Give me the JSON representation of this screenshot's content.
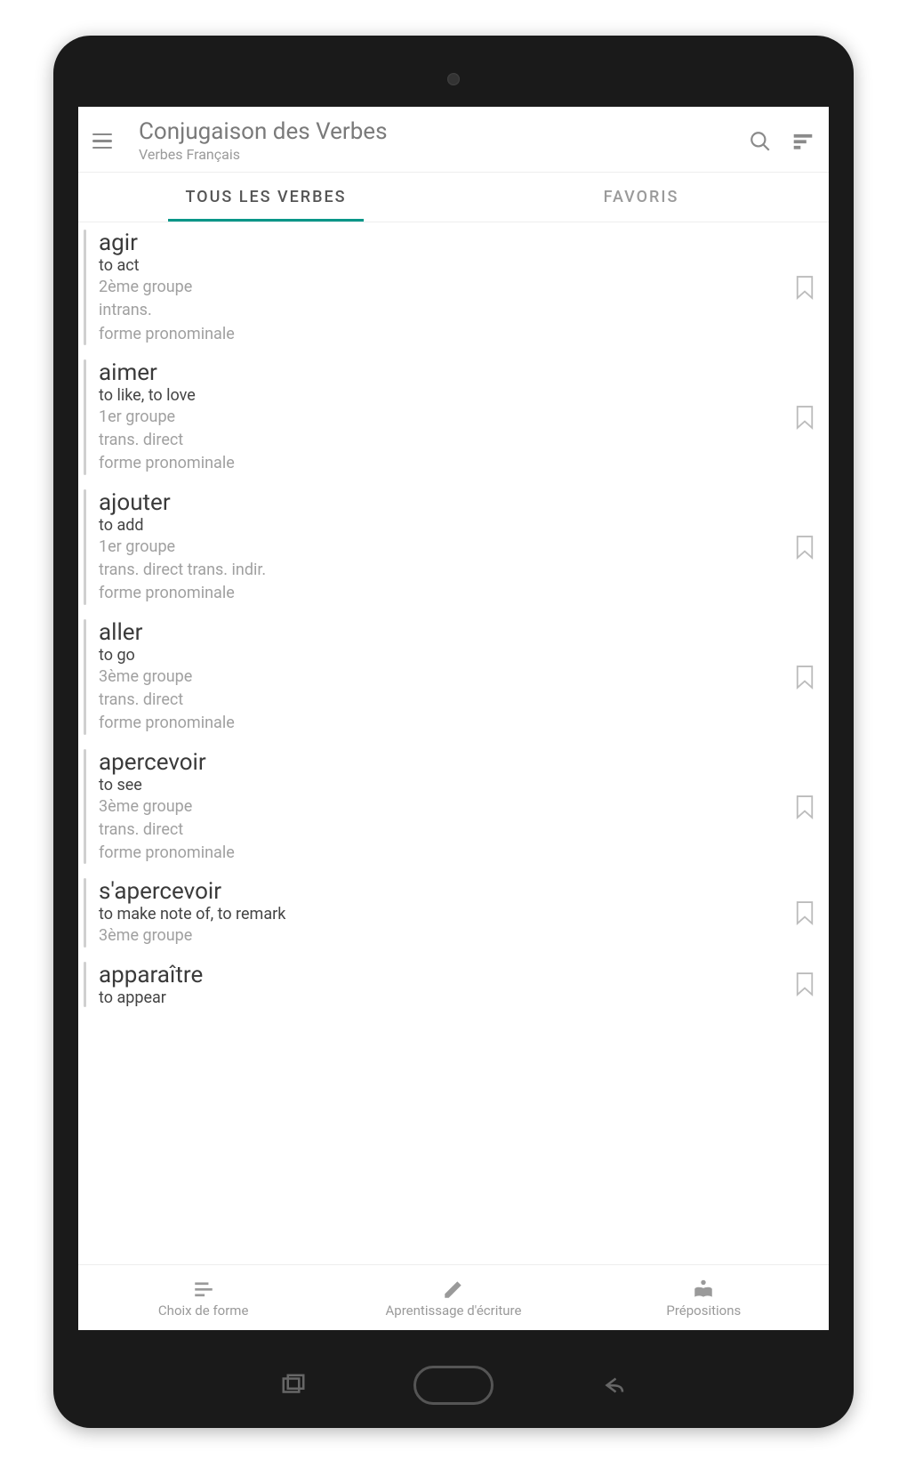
{
  "header": {
    "title": "Conjugaison des Verbes",
    "subtitle": "Verbes Français"
  },
  "tabs": {
    "all": "TOUS LES VERBES",
    "fav": "FAVORIS"
  },
  "verbs": [
    {
      "word": "agir",
      "translation": "to act",
      "group": "2ème groupe",
      "transit": "intrans.",
      "pron": "forme pronominale"
    },
    {
      "word": "aimer",
      "translation": "to like, to love",
      "group": "1er groupe",
      "transit": "trans. direct",
      "pron": "forme pronominale"
    },
    {
      "word": "ajouter",
      "translation": "to add",
      "group": "1er groupe",
      "transit": "trans. direct  trans. indir.",
      "pron": "forme pronominale"
    },
    {
      "word": "aller",
      "translation": "to go",
      "group": "3ème groupe",
      "transit": "trans. direct",
      "pron": "forme pronominale"
    },
    {
      "word": "apercevoir",
      "translation": "to see",
      "group": "3ème groupe",
      "transit": "trans. direct",
      "pron": "forme pronominale"
    },
    {
      "word": "s'apercevoir",
      "translation": "to make note of, to remark",
      "group": "3ème groupe",
      "transit": "",
      "pron": ""
    },
    {
      "word": "apparaître",
      "translation": "to appear",
      "group": "",
      "transit": "",
      "pron": ""
    }
  ],
  "bottomNav": {
    "form": "Choix de forme",
    "writing": "Aprentissage d'écriture",
    "prep": "Prépositions"
  }
}
